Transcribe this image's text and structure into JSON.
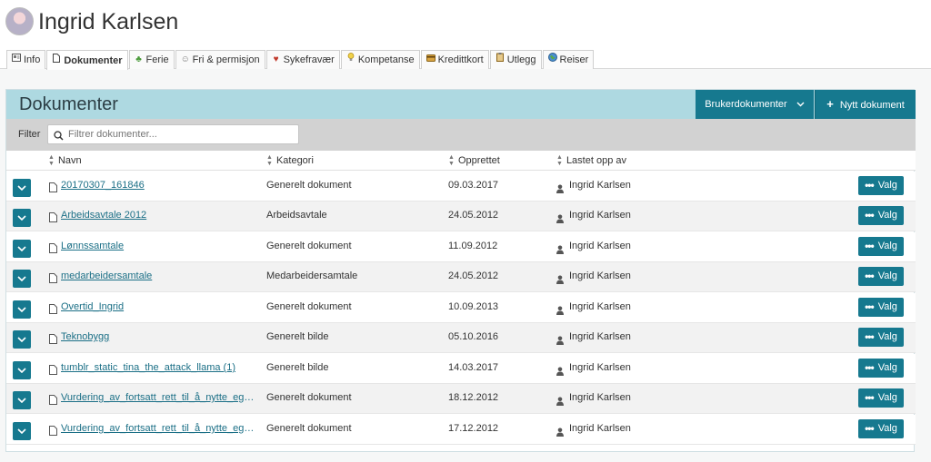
{
  "user": {
    "name": "Ingrid Karlsen"
  },
  "tabs": [
    {
      "label": "Info",
      "icon": "id-card-icon",
      "active": false
    },
    {
      "label": "Dokumenter",
      "icon": "document-icon",
      "active": true
    },
    {
      "label": "Ferie",
      "icon": "palm-tree-icon",
      "active": false
    },
    {
      "label": "Fri & permisjon",
      "icon": "people-icon",
      "active": false
    },
    {
      "label": "Sykefravær",
      "icon": "heart-icon",
      "active": false
    },
    {
      "label": "Kompetanse",
      "icon": "lightbulb-icon",
      "active": false
    },
    {
      "label": "Kredittkort",
      "icon": "credit-card-icon",
      "active": false
    },
    {
      "label": "Utlegg",
      "icon": "clipboard-icon",
      "active": false
    },
    {
      "label": "Reiser",
      "icon": "globe-icon",
      "active": false
    }
  ],
  "panel": {
    "title": "Dokumenter",
    "brukerdokumenter_label": "Brukerdokumenter",
    "nytt_dokument_label": "Nytt dokument"
  },
  "filter": {
    "label": "Filter",
    "placeholder": "Filtrer dokumenter..."
  },
  "columns": {
    "navn": "Navn",
    "kategori": "Kategori",
    "opprettet": "Opprettet",
    "lastet_opp_av": "Lastet opp av"
  },
  "rows": [
    {
      "name": "20170307_161846",
      "category": "Generelt dokument",
      "created": "09.03.2017",
      "uploaded_by": "Ingrid Karlsen",
      "action": "Valg"
    },
    {
      "name": "Arbeidsavtale 2012",
      "category": "Arbeidsavtale",
      "created": "24.05.2012",
      "uploaded_by": "Ingrid Karlsen",
      "action": "Valg"
    },
    {
      "name": "Lønnssamtale",
      "category": "Generelt dokument",
      "created": "11.09.2012",
      "uploaded_by": "Ingrid Karlsen",
      "action": "Valg"
    },
    {
      "name": "medarbeidersamtale",
      "category": "Medarbeidersamtale",
      "created": "24.05.2012",
      "uploaded_by": "Ingrid Karlsen",
      "action": "Valg"
    },
    {
      "name": "Overtid_Ingrid",
      "category": "Generelt dokument",
      "created": "10.09.2013",
      "uploaded_by": "Ingrid Karlsen",
      "action": "Valg"
    },
    {
      "name": "Teknobygg",
      "category": "Generelt bilde",
      "created": "05.10.2016",
      "uploaded_by": "Ingrid Karlsen",
      "action": "Valg"
    },
    {
      "name": "tumblr_static_tina_the_attack_llama (1)",
      "category": "Generelt bilde",
      "created": "14.03.2017",
      "uploaded_by": "Ingrid Karlsen",
      "action": "Valg"
    },
    {
      "name": "Vurdering_av_fortsatt_rett_til_å_nytte_egenmelding",
      "category": "Generelt dokument",
      "created": "18.12.2012",
      "uploaded_by": "Ingrid Karlsen",
      "action": "Valg"
    },
    {
      "name": "Vurdering_av_fortsatt_rett_til_å_nytte_egenmelding",
      "category": "Generelt dokument",
      "created": "17.12.2012",
      "uploaded_by": "Ingrid Karlsen",
      "action": "Valg"
    }
  ],
  "colors": {
    "accent": "#16798f",
    "panel_header": "#aed9e1",
    "link": "#1b6f86"
  }
}
